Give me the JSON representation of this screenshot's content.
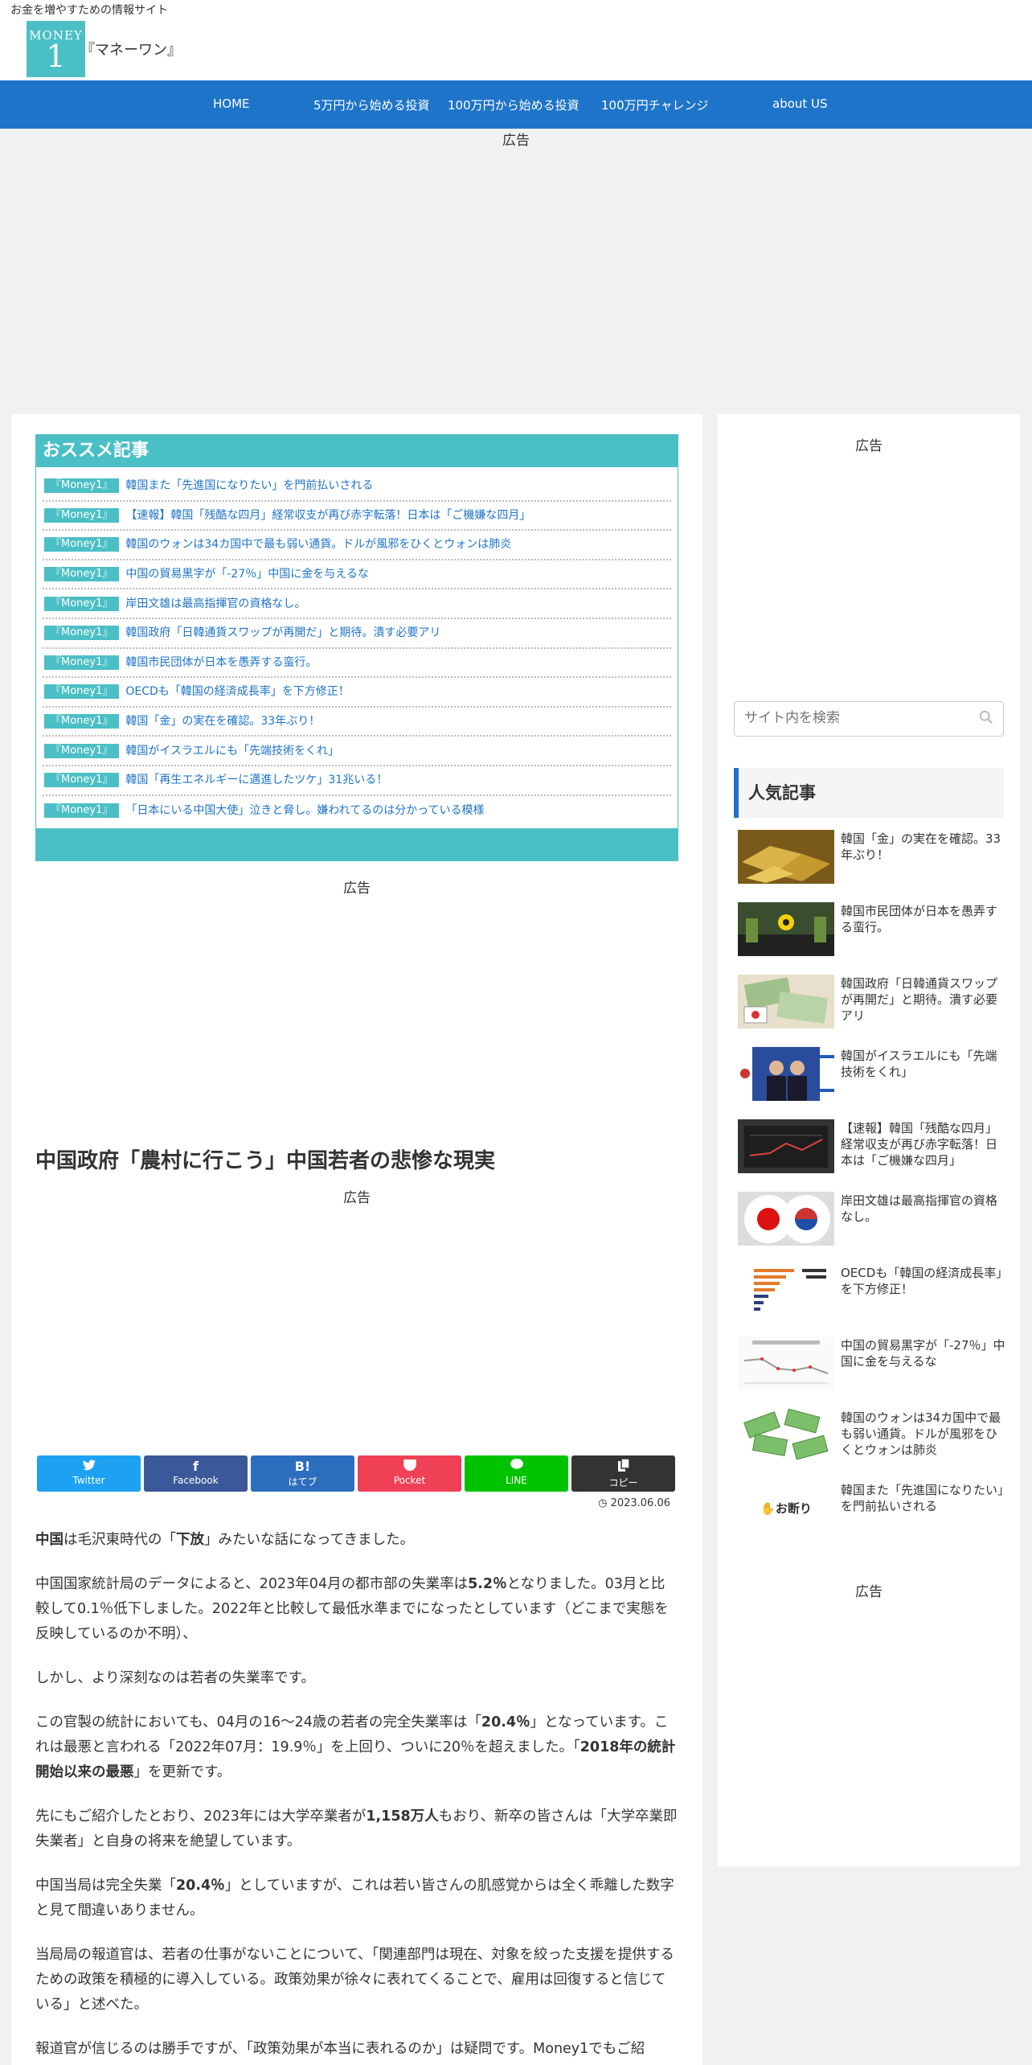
{
  "header": {
    "tagline": "お金を増やすための情報サイト",
    "logo_top": "MONEY",
    "logo_num": "1",
    "site_name": "『マネーワン』"
  },
  "nav": [
    "HOME",
    "5万円から始める投資",
    "100万円から始める投資",
    "100万円チャレンジ",
    "about US"
  ],
  "ad_label": "広告",
  "recommend": {
    "heading": "おススメ記事",
    "badge": "『Money1』",
    "items": [
      "韓国また「先進国になりたい」を門前払いされる",
      "【速報】韓国「残酷な四月」経常収支が再び赤字転落！日本は「ご機嫌な四月」",
      "韓国のウォンは34カ国中で最も弱い通貨。ドルが風邪をひくとウォンは肺炎",
      "中国の貿易黒字が「-27％」中国に金を与えるな",
      "岸田文雄は最高指揮官の資格なし。",
      "韓国政府「日韓通貨スワップが再開だ」と期待。潰す必要アリ",
      "韓国市民団体が日本を愚弄する蛮行。",
      "OECDも「韓国の経済成長率」を下方修正！",
      "韓国「金」の実在を確認。33年ぶり！",
      "韓国がイスラエルにも「先端技術をくれ」",
      "韓国「再生エネルギーに邁進したツケ」31兆いる！",
      "「日本にいる中国大使」泣きと脅し。嫌われてるのは分かっている模様"
    ]
  },
  "article": {
    "title": "中国政府「農村に行こう」中国若者の悲惨な現実",
    "date": "2023.06.06",
    "share": [
      "Twitter",
      "Facebook",
      "はてブ",
      "Pocket",
      "LINE",
      "コピー"
    ],
    "p1a": "中国",
    "p1b": "は毛沢東時代の「",
    "p1c": "下放",
    "p1d": "」みたいな話になってきました。",
    "p2a": "中国国家統計局のデータによると、2023年04月の都市部の失業率は",
    "p2b": "5.2％",
    "p2c": "となりました。03月と比較して0.1％低下しました。2022年と比較して最低水準までになったとしています（どこまで実態を反映しているのか不明）、",
    "p3": "しかし、より深刻なのは若者の失業率です。",
    "p4a": "この官製の統計においても、04月の16～24歳の若者の完全失業率は「",
    "p4b": "20.4％",
    "p4c": "」となっています。これは最悪と言われる「2022年07月：19.9％」を上回り、ついに20％を超えました。「",
    "p4d": "2018年の統計開始以来の最悪",
    "p4e": "」を更新です。",
    "p5a": "先にもご紹介したとおり、2023年には大学卒業者が",
    "p5b": "1,158万人",
    "p5c": "もおり、新卒の皆さんは「大学卒業即失業者」と自身の将来を絶望しています。",
    "p6a": "中国当局は完全失業「",
    "p6b": "20.4％",
    "p6c": "」としていますが、これは若い皆さんの肌感覚からは全く乖離した数字と見て間違いありません。",
    "p7": "当局局の報道官は、若者の仕事がないことについて、「関連部門は現在、対象を絞った支援を提供するための政策を積極的に導入している。政策効果が徐々に表れてくることで、雇用は回復すると信じている」と述べた。",
    "p8": "報道官が信じるのは勝手ですが、「政策効果が本当に表れるのか」は疑問です。Money1でもご紹"
  },
  "sidebar": {
    "search_placeholder": "サイト内を検索",
    "popular_heading": "人気記事",
    "popular": [
      "韓国「金」の実在を確認。33年ぶり！",
      "韓国市民団体が日本を愚弄する蛮行。",
      "韓国政府「日韓通貨スワップが再開だ」と期待。潰す必要アリ",
      "韓国がイスラエルにも「先端技術をくれ」",
      "【速報】韓国「残酷な四月」経常収支が再び赤字転落！日本は「ご機嫌な四月」",
      "岸田文雄は最高指揮官の資格なし。",
      "OECDも「韓国の経済成長率」を下方修正！",
      "中国の貿易黒字が「-27％」中国に金を与えるな",
      "韓国のウォンは34カ国中で最も弱い通貨。ドルが風邪をひくとウォンは肺炎",
      "韓国また「先進国になりたい」を門前払いされる"
    ],
    "thumb_text_last": "お断り"
  },
  "colors": {
    "accent": "#4bbfc6",
    "nav": "#1e74c8",
    "twitter": "#1da1f2",
    "facebook": "#3b5998",
    "hatena": "#2c6ebd",
    "pocket": "#ef4056",
    "line": "#00c300",
    "copy": "#333333"
  }
}
